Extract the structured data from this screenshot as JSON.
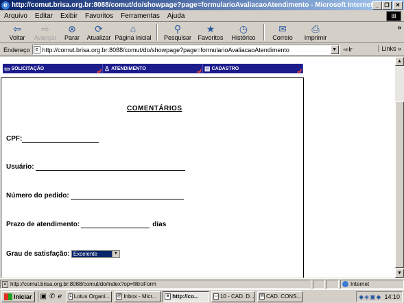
{
  "window": {
    "title": "http://comut.brisa.org.br:8088/comut/do/showpage?page=formularioAvaliacaoAtendimento - Microsoft Internet Explorer",
    "icon": "ie-icon"
  },
  "menu": {
    "items": [
      "Arquivo",
      "Editar",
      "Exibir",
      "Favoritos",
      "Ferramentas",
      "Ajuda"
    ]
  },
  "toolbar": {
    "buttons": [
      {
        "label": "Voltar",
        "icon": "back-arrow-icon",
        "glyph": "⇦"
      },
      {
        "label": "Avançar",
        "icon": "forward-arrow-icon",
        "glyph": "⇨"
      },
      {
        "label": "Parar",
        "icon": "stop-icon",
        "glyph": "⊗"
      },
      {
        "label": "Atualizar",
        "icon": "refresh-icon",
        "glyph": "⟳"
      },
      {
        "label": "Página inicial",
        "icon": "home-icon",
        "glyph": "⌂"
      },
      {
        "label": "Pesquisar",
        "icon": "search-icon",
        "glyph": "⚲"
      },
      {
        "label": "Favoritos",
        "icon": "favorites-icon",
        "glyph": "★"
      },
      {
        "label": "Histórico",
        "icon": "history-icon",
        "glyph": "◷"
      },
      {
        "label": "Correio",
        "icon": "mail-icon",
        "glyph": "✉"
      },
      {
        "label": "Imprimir",
        "icon": "print-icon",
        "glyph": "⎙"
      }
    ],
    "overflow": "»"
  },
  "address": {
    "label": "Endereço",
    "url": "http://comut.brisa.org.br:8088/comut/do/showpage?page=formularioAvaliacaoAtendimento",
    "go": "Ir",
    "links": "Links »"
  },
  "nav_tabs": [
    "SOLICITAÇÃO",
    "ATENDIMENTO",
    "CADASTRO"
  ],
  "form": {
    "title": "COMENTÁRIOS",
    "cpf_label": "CPF:",
    "usuario_label": "Usuário:",
    "pedido_label": "Número do pedido:",
    "prazo_label": "Prazo de atendimento:",
    "prazo_suffix": "dias",
    "grau_label": "Grau de satisfação:",
    "grau_value": "Excelente"
  },
  "status": {
    "text": "http://comut.brisa.org.br:8088/comut/do/index?op=filtroForm",
    "zone": "Internet"
  },
  "taskbar": {
    "start": "Iniciar",
    "tasks": [
      "Lotus Organi...",
      "Inbox - Micr...",
      "http://co...",
      "10 - CAD. D...",
      "CAD. CONS..."
    ],
    "active_index": 2,
    "clock": "14:10"
  }
}
